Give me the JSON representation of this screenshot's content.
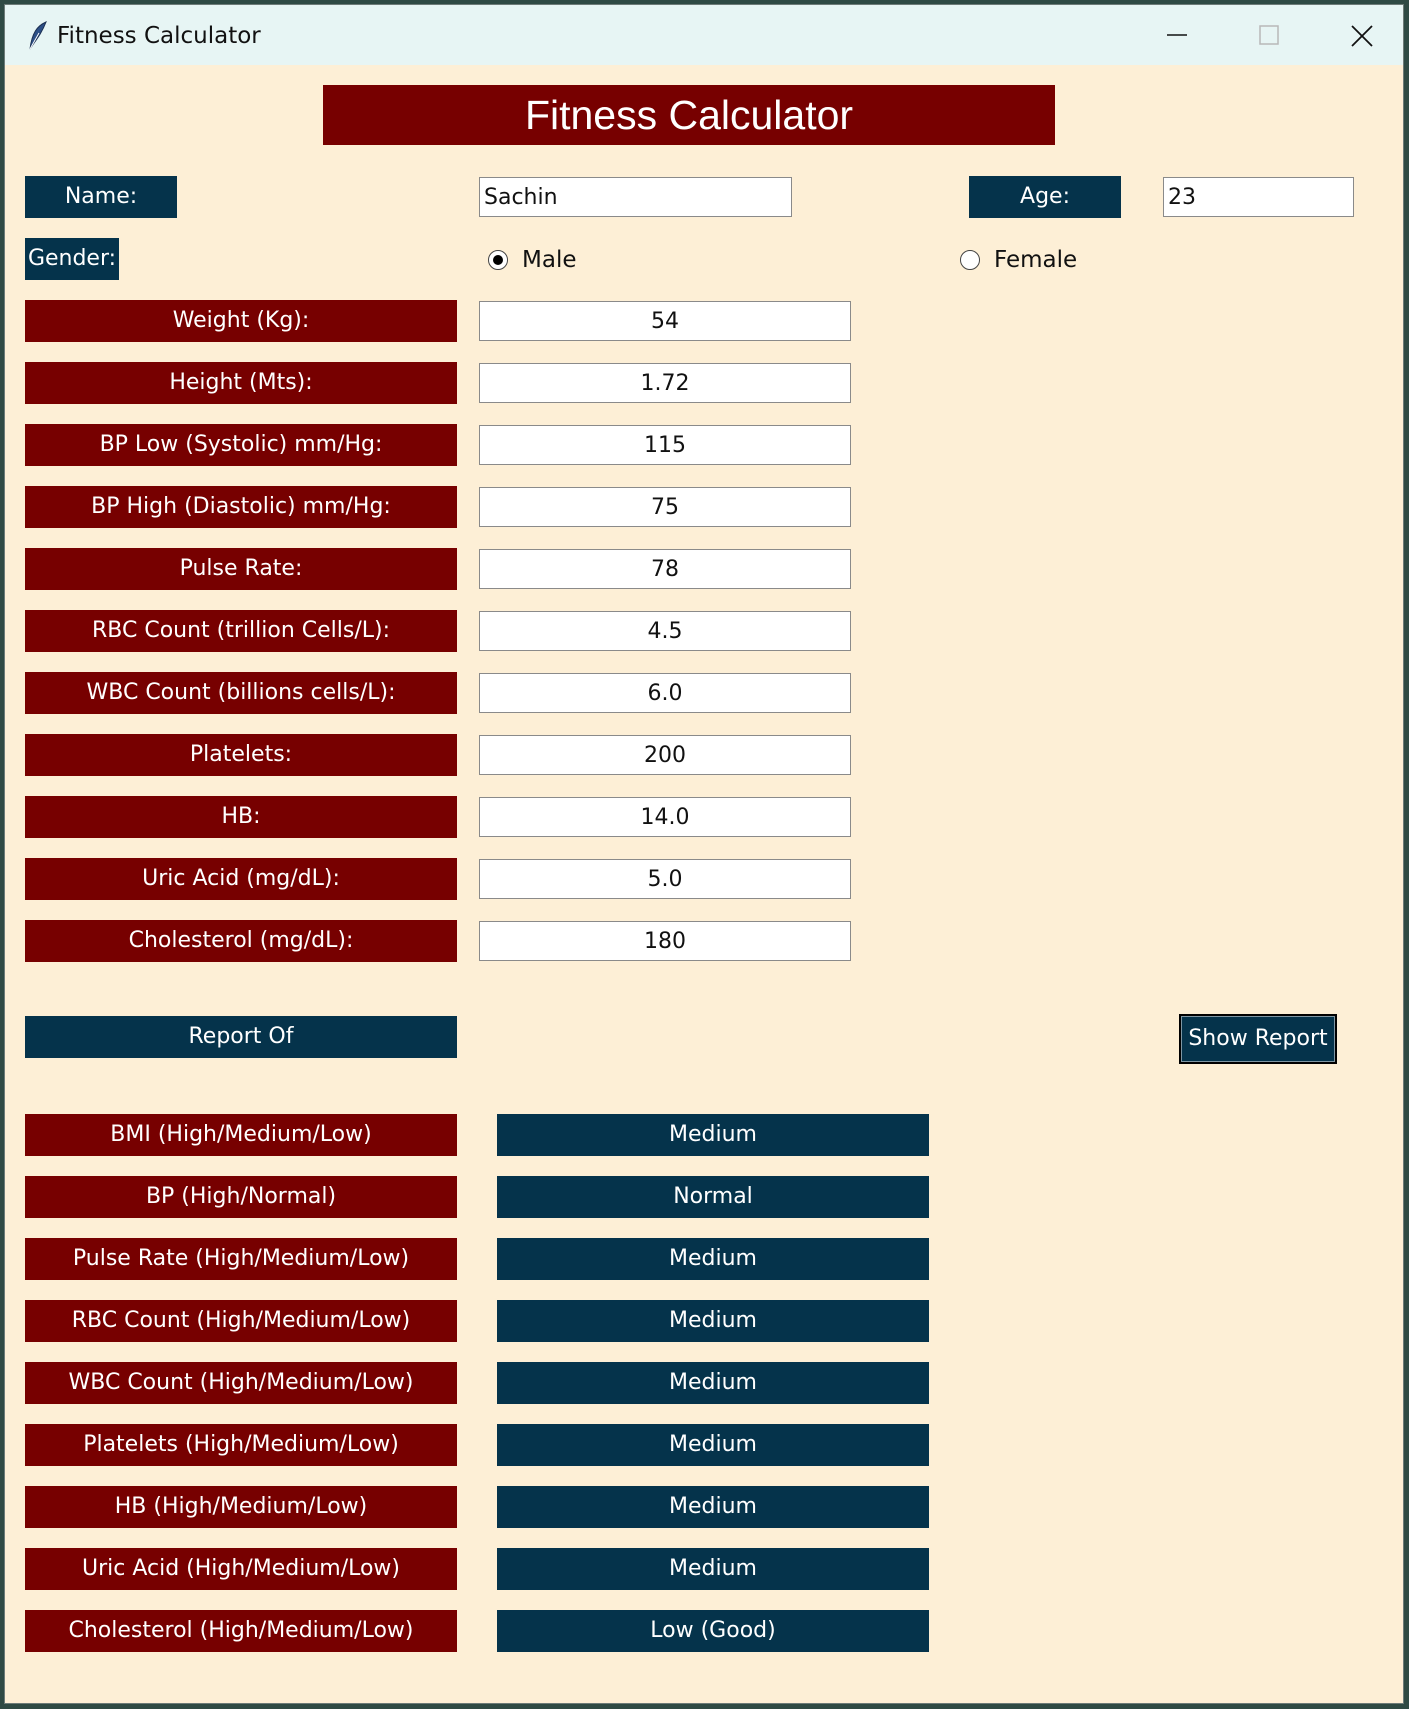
{
  "window": {
    "title": "Fitness Calculator"
  },
  "header": {
    "title": "Fitness Calculator"
  },
  "name": {
    "label": "Name:",
    "value": "Sachin"
  },
  "age": {
    "label": "Age:",
    "value": "23"
  },
  "gender": {
    "label": "Gender:",
    "options": [
      "Male",
      "Female"
    ],
    "selected": "Male"
  },
  "inputs": [
    {
      "label": "Weight (Kg):",
      "value": "54"
    },
    {
      "label": "Height (Mts):",
      "value": "1.72"
    },
    {
      "label": "BP Low (Systolic) mm/Hg:",
      "value": "115"
    },
    {
      "label": "BP High (Diastolic) mm/Hg:",
      "value": "75"
    },
    {
      "label": "Pulse Rate:",
      "value": "78"
    },
    {
      "label": "RBC Count (trillion Cells/L):",
      "value": "4.5"
    },
    {
      "label": "WBC Count (billions cells/L):",
      "value": "6.0"
    },
    {
      "label": "Platelets:",
      "value": "200"
    },
    {
      "label": "HB:",
      "value": "14.0"
    },
    {
      "label": "Uric Acid (mg/dL):",
      "value": "5.0"
    },
    {
      "label": "Cholesterol (mg/dL):",
      "value": "180"
    }
  ],
  "report_of_label": "Report Of",
  "show_report_label": "Show Report",
  "results": [
    {
      "label": "BMI (High/Medium/Low)",
      "value": "Medium"
    },
    {
      "label": "BP (High/Normal)",
      "value": "Normal"
    },
    {
      "label": "Pulse Rate (High/Medium/Low)",
      "value": "Medium"
    },
    {
      "label": "RBC Count (High/Medium/Low)",
      "value": "Medium"
    },
    {
      "label": "WBC Count (High/Medium/Low)",
      "value": "Medium"
    },
    {
      "label": "Platelets (High/Medium/Low)",
      "value": "Medium"
    },
    {
      "label": "HB (High/Medium/Low)",
      "value": "Medium"
    },
    {
      "label": "Uric Acid (High/Medium/Low)",
      "value": "Medium"
    },
    {
      "label": "Cholesterol (High/Medium/Low)",
      "value": "Low (Good)"
    }
  ],
  "colors": {
    "label_red": "#770000",
    "label_navy": "#05334b",
    "background": "#fdefd6"
  },
  "icons": [
    "feather-icon",
    "minimize-icon",
    "maximize-icon",
    "close-icon"
  ]
}
